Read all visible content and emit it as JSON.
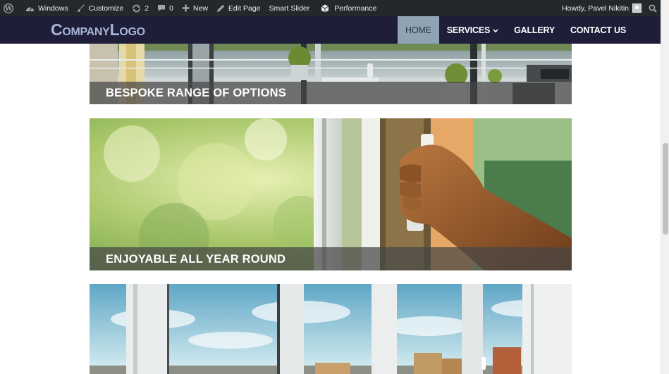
{
  "admin_bar": {
    "site_name": "Windows",
    "customize": "Customize",
    "updates_count": "2",
    "comments_count": "0",
    "new": "New",
    "edit_page": "Edit Page",
    "smart_slider": "Smart Slider",
    "performance": "Performance",
    "greeting": "Howdy, Pavel Nikitin"
  },
  "logo": {
    "part1_big": "C",
    "part1_small": "OMPANY",
    "part2_big": "L",
    "part2_small": "OGO"
  },
  "nav": {
    "items": [
      {
        "label": "HOME",
        "active": true
      },
      {
        "label": "SERVICES",
        "has_dropdown": true
      },
      {
        "label": "GALLERY"
      },
      {
        "label": "CONTACT US"
      }
    ]
  },
  "banners": [
    {
      "caption": "BESPOKE RANGE OF OPTIONS"
    },
    {
      "caption": "ENJOYABLE ALL YEAR ROUND"
    },
    {
      "caption": ""
    }
  ],
  "colors": {
    "admin_bar_bg": "#23282d",
    "header_bg": "#1e1e38",
    "nav_active_bg": "#8fa3b3",
    "logo": "#aab4d6"
  }
}
